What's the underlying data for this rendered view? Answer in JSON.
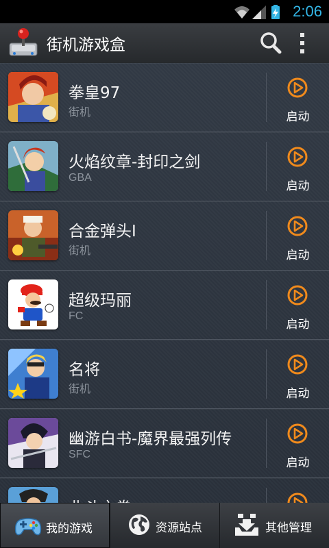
{
  "status_bar": {
    "time": "2:06"
  },
  "app_bar": {
    "title": "街机游戏盒",
    "logo_icon": "arcade-joystick-icon",
    "search_icon": "search-icon",
    "menu_icon": "overflow-menu-icon"
  },
  "launch_label": "启动",
  "games": [
    {
      "name": "拳皇97",
      "platform": "街机",
      "thumb": "kof97"
    },
    {
      "name": "火焰纹章-封印之剑",
      "platform": "GBA",
      "thumb": "fire-emblem"
    },
    {
      "name": "合金弹头I",
      "platform": "街机",
      "thumb": "metal-slug"
    },
    {
      "name": "超级玛丽",
      "platform": "FC",
      "thumb": "mario"
    },
    {
      "name": "名将",
      "platform": "街机",
      "thumb": "captain-commando"
    },
    {
      "name": "幽游白书-魔界最强列传",
      "platform": "SFC",
      "thumb": "yuyu-hakusho"
    },
    {
      "name": "北斗之拳",
      "platform": "",
      "thumb": "hokuto-no-ken"
    }
  ],
  "tabs": [
    {
      "label": "我的游戏",
      "icon": "gamepad-icon",
      "active": true
    },
    {
      "label": "资源站点",
      "icon": "globe-icon",
      "active": false
    },
    {
      "label": "其他管理",
      "icon": "download-tray-icon",
      "active": false
    }
  ],
  "colors": {
    "accent": "#33b5e5",
    "launch_orange": "#f08a1c"
  }
}
